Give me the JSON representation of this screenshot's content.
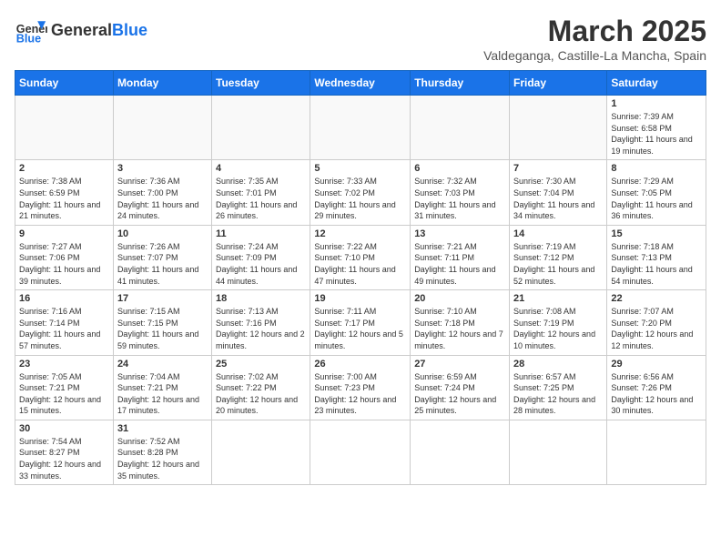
{
  "header": {
    "logo_general": "General",
    "logo_blue": "Blue",
    "month_title": "March 2025",
    "location": "Valdeganga, Castille-La Mancha, Spain"
  },
  "weekdays": [
    "Sunday",
    "Monday",
    "Tuesday",
    "Wednesday",
    "Thursday",
    "Friday",
    "Saturday"
  ],
  "weeks": [
    [
      {
        "day": "",
        "info": ""
      },
      {
        "day": "",
        "info": ""
      },
      {
        "day": "",
        "info": ""
      },
      {
        "day": "",
        "info": ""
      },
      {
        "day": "",
        "info": ""
      },
      {
        "day": "",
        "info": ""
      },
      {
        "day": "1",
        "info": "Sunrise: 7:39 AM\nSunset: 6:58 PM\nDaylight: 11 hours and 19 minutes."
      }
    ],
    [
      {
        "day": "2",
        "info": "Sunrise: 7:38 AM\nSunset: 6:59 PM\nDaylight: 11 hours and 21 minutes."
      },
      {
        "day": "3",
        "info": "Sunrise: 7:36 AM\nSunset: 7:00 PM\nDaylight: 11 hours and 24 minutes."
      },
      {
        "day": "4",
        "info": "Sunrise: 7:35 AM\nSunset: 7:01 PM\nDaylight: 11 hours and 26 minutes."
      },
      {
        "day": "5",
        "info": "Sunrise: 7:33 AM\nSunset: 7:02 PM\nDaylight: 11 hours and 29 minutes."
      },
      {
        "day": "6",
        "info": "Sunrise: 7:32 AM\nSunset: 7:03 PM\nDaylight: 11 hours and 31 minutes."
      },
      {
        "day": "7",
        "info": "Sunrise: 7:30 AM\nSunset: 7:04 PM\nDaylight: 11 hours and 34 minutes."
      },
      {
        "day": "8",
        "info": "Sunrise: 7:29 AM\nSunset: 7:05 PM\nDaylight: 11 hours and 36 minutes."
      }
    ],
    [
      {
        "day": "9",
        "info": "Sunrise: 7:27 AM\nSunset: 7:06 PM\nDaylight: 11 hours and 39 minutes."
      },
      {
        "day": "10",
        "info": "Sunrise: 7:26 AM\nSunset: 7:07 PM\nDaylight: 11 hours and 41 minutes."
      },
      {
        "day": "11",
        "info": "Sunrise: 7:24 AM\nSunset: 7:09 PM\nDaylight: 11 hours and 44 minutes."
      },
      {
        "day": "12",
        "info": "Sunrise: 7:22 AM\nSunset: 7:10 PM\nDaylight: 11 hours and 47 minutes."
      },
      {
        "day": "13",
        "info": "Sunrise: 7:21 AM\nSunset: 7:11 PM\nDaylight: 11 hours and 49 minutes."
      },
      {
        "day": "14",
        "info": "Sunrise: 7:19 AM\nSunset: 7:12 PM\nDaylight: 11 hours and 52 minutes."
      },
      {
        "day": "15",
        "info": "Sunrise: 7:18 AM\nSunset: 7:13 PM\nDaylight: 11 hours and 54 minutes."
      }
    ],
    [
      {
        "day": "16",
        "info": "Sunrise: 7:16 AM\nSunset: 7:14 PM\nDaylight: 11 hours and 57 minutes."
      },
      {
        "day": "17",
        "info": "Sunrise: 7:15 AM\nSunset: 7:15 PM\nDaylight: 11 hours and 59 minutes."
      },
      {
        "day": "18",
        "info": "Sunrise: 7:13 AM\nSunset: 7:16 PM\nDaylight: 12 hours and 2 minutes."
      },
      {
        "day": "19",
        "info": "Sunrise: 7:11 AM\nSunset: 7:17 PM\nDaylight: 12 hours and 5 minutes."
      },
      {
        "day": "20",
        "info": "Sunrise: 7:10 AM\nSunset: 7:18 PM\nDaylight: 12 hours and 7 minutes."
      },
      {
        "day": "21",
        "info": "Sunrise: 7:08 AM\nSunset: 7:19 PM\nDaylight: 12 hours and 10 minutes."
      },
      {
        "day": "22",
        "info": "Sunrise: 7:07 AM\nSunset: 7:20 PM\nDaylight: 12 hours and 12 minutes."
      }
    ],
    [
      {
        "day": "23",
        "info": "Sunrise: 7:05 AM\nSunset: 7:21 PM\nDaylight: 12 hours and 15 minutes."
      },
      {
        "day": "24",
        "info": "Sunrise: 7:04 AM\nSunset: 7:21 PM\nDaylight: 12 hours and 17 minutes."
      },
      {
        "day": "25",
        "info": "Sunrise: 7:02 AM\nSunset: 7:22 PM\nDaylight: 12 hours and 20 minutes."
      },
      {
        "day": "26",
        "info": "Sunrise: 7:00 AM\nSunset: 7:23 PM\nDaylight: 12 hours and 23 minutes."
      },
      {
        "day": "27",
        "info": "Sunrise: 6:59 AM\nSunset: 7:24 PM\nDaylight: 12 hours and 25 minutes."
      },
      {
        "day": "28",
        "info": "Sunrise: 6:57 AM\nSunset: 7:25 PM\nDaylight: 12 hours and 28 minutes."
      },
      {
        "day": "29",
        "info": "Sunrise: 6:56 AM\nSunset: 7:26 PM\nDaylight: 12 hours and 30 minutes."
      }
    ],
    [
      {
        "day": "30",
        "info": "Sunrise: 7:54 AM\nSunset: 8:27 PM\nDaylight: 12 hours and 33 minutes."
      },
      {
        "day": "31",
        "info": "Sunrise: 7:52 AM\nSunset: 8:28 PM\nDaylight: 12 hours and 35 minutes."
      },
      {
        "day": "",
        "info": ""
      },
      {
        "day": "",
        "info": ""
      },
      {
        "day": "",
        "info": ""
      },
      {
        "day": "",
        "info": ""
      },
      {
        "day": "",
        "info": ""
      }
    ]
  ]
}
